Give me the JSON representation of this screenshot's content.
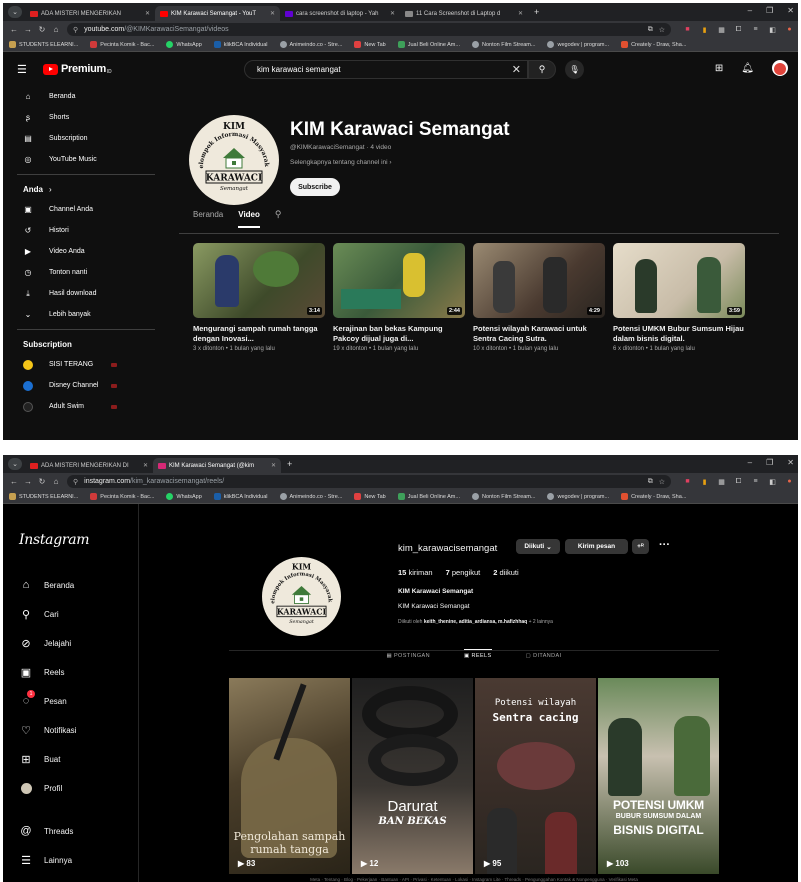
{
  "browser1": {
    "tabs": [
      {
        "title": "ADA MISTERI MENGERIKAN",
        "color": "#e02020",
        "active": false
      },
      {
        "title": "KIM Karawaci Semangat - YouT",
        "color": "#ff0000",
        "active": true
      },
      {
        "title": "cara screenshot di laptop - Yah",
        "color": "#6001d2",
        "active": false
      },
      {
        "title": "11 Cara Screenshot di Laptop d",
        "color": "#888888",
        "active": false
      }
    ],
    "url_host": "youtube.com",
    "url_path": "/@KIMKarawaciSemangat/videos",
    "bookmarks": [
      "STUDENTS ELEARNI...",
      "Pecinta Komik - Bac...",
      "WhatsApp",
      "klikBCA Individual",
      "Animeindo.co - Stre...",
      "New Tab",
      "Jual Beli Online Am...",
      "Nonton Film Stream...",
      "wegodev | program...",
      "Creately - Draw, Sha..."
    ]
  },
  "browser2": {
    "tabs": [
      {
        "title": "ADA MISTERI MENGERIKAN DI",
        "color": "#e02020",
        "active": false
      },
      {
        "title": "KIM Karawaci Semangat (@kim",
        "color": "#d62976",
        "active": true
      }
    ],
    "url_host": "instagram.com",
    "url_path": "/kim_karawacisemangat/reels/",
    "bookmarks": [
      "STUDENTS ELEARNI...",
      "Pecinta Komik - Bac...",
      "WhatsApp",
      "klikBCA Individual",
      "Animeindo.co - Stre...",
      "New Tab",
      "Jual Beli Online Am...",
      "Nonton Film Stream...",
      "wegodev | program...",
      "Creately - Draw, Sha..."
    ]
  },
  "youtube": {
    "logo_text": "Premium",
    "search_value": "kim karawaci semangat",
    "sidebar_main": [
      "Beranda",
      "Shorts",
      "Subscription",
      "YouTube Music"
    ],
    "you_header": "Anda",
    "sidebar_you": [
      "Channel Anda",
      "Histori",
      "Video Anda",
      "Tonton nanti",
      "Hasil download",
      "Lebih banyak"
    ],
    "subs_header": "Subscription",
    "subscriptions": [
      {
        "name": "SISI TERANG",
        "color": "#f5c518"
      },
      {
        "name": "Disney Channel",
        "color": "#1b6fd1"
      },
      {
        "name": "Adult Swim",
        "color": "#222222"
      }
    ],
    "channel": {
      "title": "KIM Karawaci Semangat",
      "handle": "@KIMKarawaciSemangat",
      "video_count": "4 video",
      "more": "Selengkapnya tentang channel ini",
      "subscribe": "Subscribe"
    },
    "tabs": [
      "Beranda",
      "Video"
    ],
    "videos": [
      {
        "title": "Mengurangi sampah rumah tangga dengan Inovasi...",
        "meta": "3 x ditonton • 1 bulan yang lalu",
        "duration": "3:14",
        "c1": "#7c8a5a",
        "c2": "#3e4a2a"
      },
      {
        "title": "Kerajinan ban bekas Kampung Pakcoy dijual juga di...",
        "meta": "19 x ditonton • 1 bulan yang lalu",
        "duration": "2:44",
        "c1": "#6a8c56",
        "c2": "#c9b13a"
      },
      {
        "title": "Potensi wilayah Karawaci untuk Sentra Cacing Sutra.",
        "meta": "10 x ditonton • 1 bulan yang lalu",
        "duration": "4:29",
        "c1": "#8a7a62",
        "c2": "#3a2e25"
      },
      {
        "title": "Potensi UMKM Bubur Sumsum Hijau dalam bisnis digital.",
        "meta": "6 x ditonton • 1 bulan yang lalu",
        "duration": "3:59",
        "c1": "#d8d0c0",
        "c2": "#4a6a3a"
      }
    ]
  },
  "logo": {
    "top": "KIM",
    "arc": "Kelompok Informasi Masyarakat",
    "main": "KARAWACI",
    "sub": "Semangat"
  },
  "instagram": {
    "logo": "Instagram",
    "nav": [
      "Beranda",
      "Cari",
      "Jelajahi",
      "Reels",
      "Pesan",
      "Notifikasi",
      "Buat",
      "Profil"
    ],
    "nav_bottom": [
      "Threads",
      "Lainnya"
    ],
    "message_badge": "1",
    "username": "kim_karawacisemangat",
    "btn_following": "Diikuti",
    "btn_message": "Kirim pesan",
    "posts_num": "15",
    "posts_label": "kiriman",
    "followers_num": "7",
    "followers_label": "pengikut",
    "following_num": "2",
    "following_label": "diikuti",
    "name": "KIM Karawaci Semangat",
    "bio": "KIM Karawaci Semangat",
    "followed_by_prefix": "Diikuti oleh",
    "followed_by_names": "keith_thenine, aditia_ardiansa, m.hafizhhaq",
    "followed_by_more": "+ 2 lainnya",
    "tabs": [
      "POSTINGAN",
      "REELS",
      "DITANDAI"
    ],
    "reels": [
      {
        "overlay": "Pengolahan sampah rumah tangga",
        "count": "83",
        "c1": "#6a5a40",
        "c2": "#2a2418"
      },
      {
        "overlay": "Darurat",
        "overlay2": "BAN BEKAS",
        "count": "12",
        "c1": "#2c2c2c",
        "c2": "#7a6a5a"
      },
      {
        "overlay": "Potensi wilayah",
        "overlay2": "Sentra cacing",
        "count": "95",
        "c1": "#4a3a32",
        "c2": "#2a2520"
      },
      {
        "overlay": "POTENSI UMKM",
        "overlay2": "BUBUR SUMSUM DALAM",
        "overlay3": "BISNIS DIGITAL",
        "count": "103",
        "c1": "#5a7a4a",
        "c2": "#3a4a2a"
      }
    ],
    "footer": "Meta · Tentang · Blog · Pekerjaan · Bantuan · API · Privasi · Ketentuan · Lokasi · Instagram Lite · Threads · Pengunggahan Kontak & Nonpengguna · Verifikasi Meta"
  }
}
